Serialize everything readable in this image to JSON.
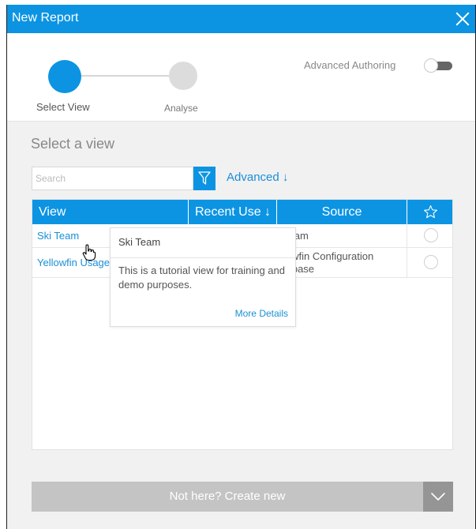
{
  "dialog": {
    "title": "New Report"
  },
  "stepper": {
    "steps": [
      {
        "label": "Select View",
        "active": true
      },
      {
        "label": "Analyse",
        "active": false
      }
    ]
  },
  "advanced_authoring": {
    "label": "Advanced Authoring",
    "enabled": false
  },
  "section": {
    "title": "Select a view"
  },
  "search": {
    "placeholder": "Search",
    "value": "",
    "advanced_label": "Advanced ↓"
  },
  "table": {
    "headers": {
      "view": "View",
      "recent": "Recent Use ↓",
      "source": "Source",
      "favourite_icon": "star-icon"
    },
    "rows": [
      {
        "view": "Ski Team",
        "recent": "",
        "source": "Team"
      },
      {
        "view": "Yellowfin Usage",
        "recent": "",
        "source": "lowfin Configuration tabase"
      }
    ]
  },
  "tooltip": {
    "title": "Ski Team",
    "description": "This is a tutorial view for training and demo purposes.",
    "more_link": "More Details"
  },
  "footer": {
    "create_label": "Not here? Create new"
  },
  "colors": {
    "accent": "#0c94e3",
    "link": "#1a8fd6",
    "create_button": "#c4c4c4",
    "create_dropdown": "#959595"
  }
}
